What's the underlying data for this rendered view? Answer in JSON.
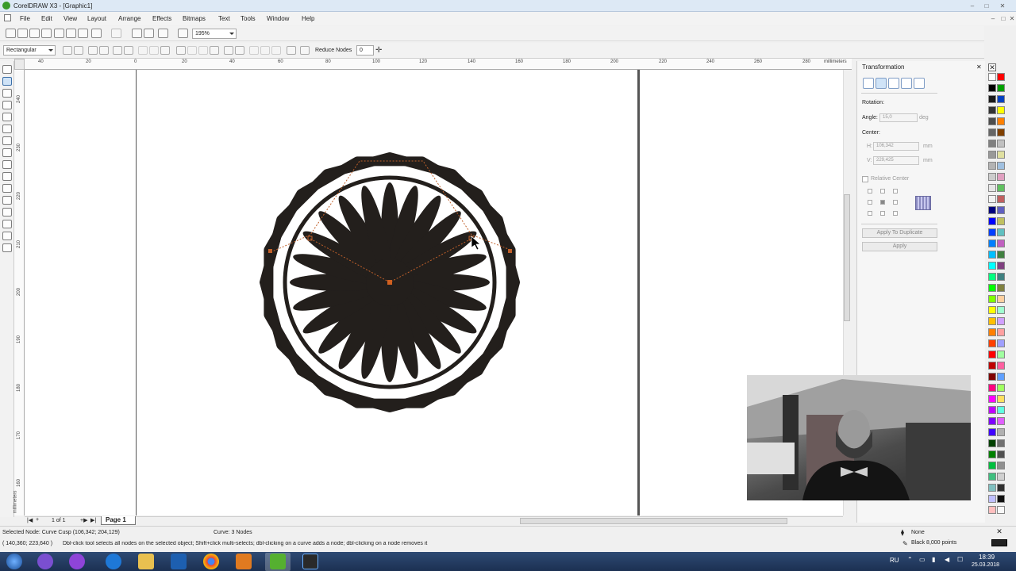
{
  "window": {
    "title": "CorelDRAW X3 - [Graphic1]",
    "controls": [
      "–",
      "□",
      "✕"
    ],
    "doc_controls": [
      "–",
      "□",
      "✕"
    ]
  },
  "menu": [
    "File",
    "Edit",
    "View",
    "Layout",
    "Arrange",
    "Effects",
    "Bitmaps",
    "Text",
    "Tools",
    "Window",
    "Help"
  ],
  "standard_toolbar": {
    "zoom_value": "195%"
  },
  "property_bar": {
    "selection_mode": "Rectangular",
    "reduce_nodes_label": "Reduce Nodes",
    "reduce_nodes_value": "0"
  },
  "ruler": {
    "h_ticks": [
      "40",
      "20",
      "0",
      "20",
      "40",
      "60",
      "80",
      "100",
      "120",
      "140",
      "160",
      "180",
      "200",
      "220",
      "240",
      "260",
      "280"
    ],
    "h_unit": "millimeters",
    "v_ticks": [
      "240",
      "230",
      "220",
      "210",
      "200",
      "190",
      "180",
      "170",
      "160",
      "150",
      "140",
      "130",
      "120"
    ],
    "v_unit": "millimeters"
  },
  "page_nav": {
    "count": "1 of 1",
    "tab_label": "Page 1"
  },
  "docker": {
    "title": "Transformation",
    "section": "Rotation:",
    "angle_label": "Angle:",
    "angle_value": "15,0",
    "angle_unit": "deg",
    "center_label": "Center:",
    "h_label": "H:",
    "h_value": "106,342",
    "h_unit": "mm",
    "v_label": "V:",
    "v_value": "229,425",
    "v_unit": "mm",
    "relative_center_label": "Relative Center",
    "apply_duplicate_label": "Apply To Duplicate",
    "apply_label": "Apply"
  },
  "status": {
    "selected_node": "Selected Node: Curve Cusp (106,342; 204,129)",
    "curve_info": "Curve: 3 Nodes",
    "coords": "( 140,360; 223,640 )",
    "hint": "Dbl-click tool selects all nodes on the selected object; Shift+click multi-selects; dbl-clicking on a curve adds a node; dbl-clicking on a node removes it",
    "fill": "None",
    "outline": "Black  8,000 points"
  },
  "taskbar": {
    "lang": "RU",
    "time": "18:39",
    "date": "25.03.2018"
  },
  "palette_colors": [
    "#ffffff",
    "#000000",
    "#1a1a1a",
    "#333333",
    "#4d4d4d",
    "#666666",
    "#808080",
    "#999999",
    "#b3b3b3",
    "#cccccc",
    "#e6e6e6",
    "#f2f2f2",
    "#00007f",
    "#0000ff",
    "#003fff",
    "#007fff",
    "#00bfff",
    "#00ffff",
    "#00ff7f",
    "#00ff00",
    "#7fff00",
    "#ffff00",
    "#ffbf00",
    "#ff7f00",
    "#ff3f00",
    "#ff0000",
    "#bf0000",
    "#7f0000",
    "#ff007f",
    "#ff00ff",
    "#bf00ff",
    "#7f00ff",
    "#3f00ff",
    "#004000",
    "#008000",
    "#00bf3f",
    "#3fbf7f",
    "#7fbfbf",
    "#bfbfff",
    "#ffbfbf"
  ],
  "palette_colors_2": [
    "#ff0000",
    "#00a000",
    "#0040c0",
    "#ffff00",
    "#ff8000",
    "#804000",
    "#c0c0c0",
    "#e0e0a0",
    "#a0c0e0",
    "#e0a0c0",
    "#60c060",
    "#c06060",
    "#6060c0",
    "#c0c060",
    "#60c0c0",
    "#c060c0",
    "#408040",
    "#804080",
    "#408080",
    "#808040",
    "#ffd0a0",
    "#a0ffd0",
    "#d0a0ff",
    "#ffa0a0",
    "#a0a0ff",
    "#a0ffa0",
    "#ff60a0",
    "#60a0ff",
    "#a0ff60",
    "#ffe060",
    "#60ffe0",
    "#e060ff",
    "#b0b0b0",
    "#707070",
    "#505050",
    "#909090",
    "#d0d0d0",
    "#303030",
    "#101010",
    "#f8f8f8"
  ]
}
